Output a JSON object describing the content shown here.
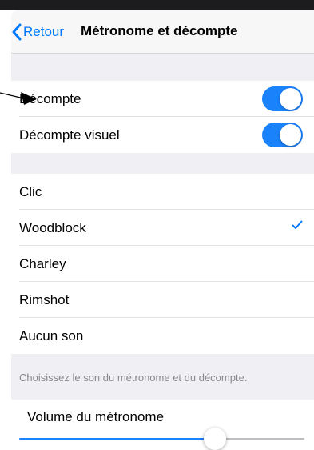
{
  "nav": {
    "back_label": "Retour",
    "title": "Métronome et décompte"
  },
  "toggles": [
    {
      "label": "Décompte",
      "on": true
    },
    {
      "label": "Décompte visuel",
      "on": true
    }
  ],
  "sounds": {
    "items": [
      {
        "label": "Clic",
        "selected": false
      },
      {
        "label": "Woodblock",
        "selected": true
      },
      {
        "label": "Charley",
        "selected": false
      },
      {
        "label": "Rimshot",
        "selected": false
      },
      {
        "label": "Aucun son",
        "selected": false
      }
    ],
    "footer": "Choisissez le son du métronome et du décompte."
  },
  "volume": {
    "label": "Volume du métronome",
    "level": 0.69
  },
  "colors": {
    "accent": "#007aff",
    "toggle_on": "#1a82fb",
    "background": "#efeff4"
  }
}
